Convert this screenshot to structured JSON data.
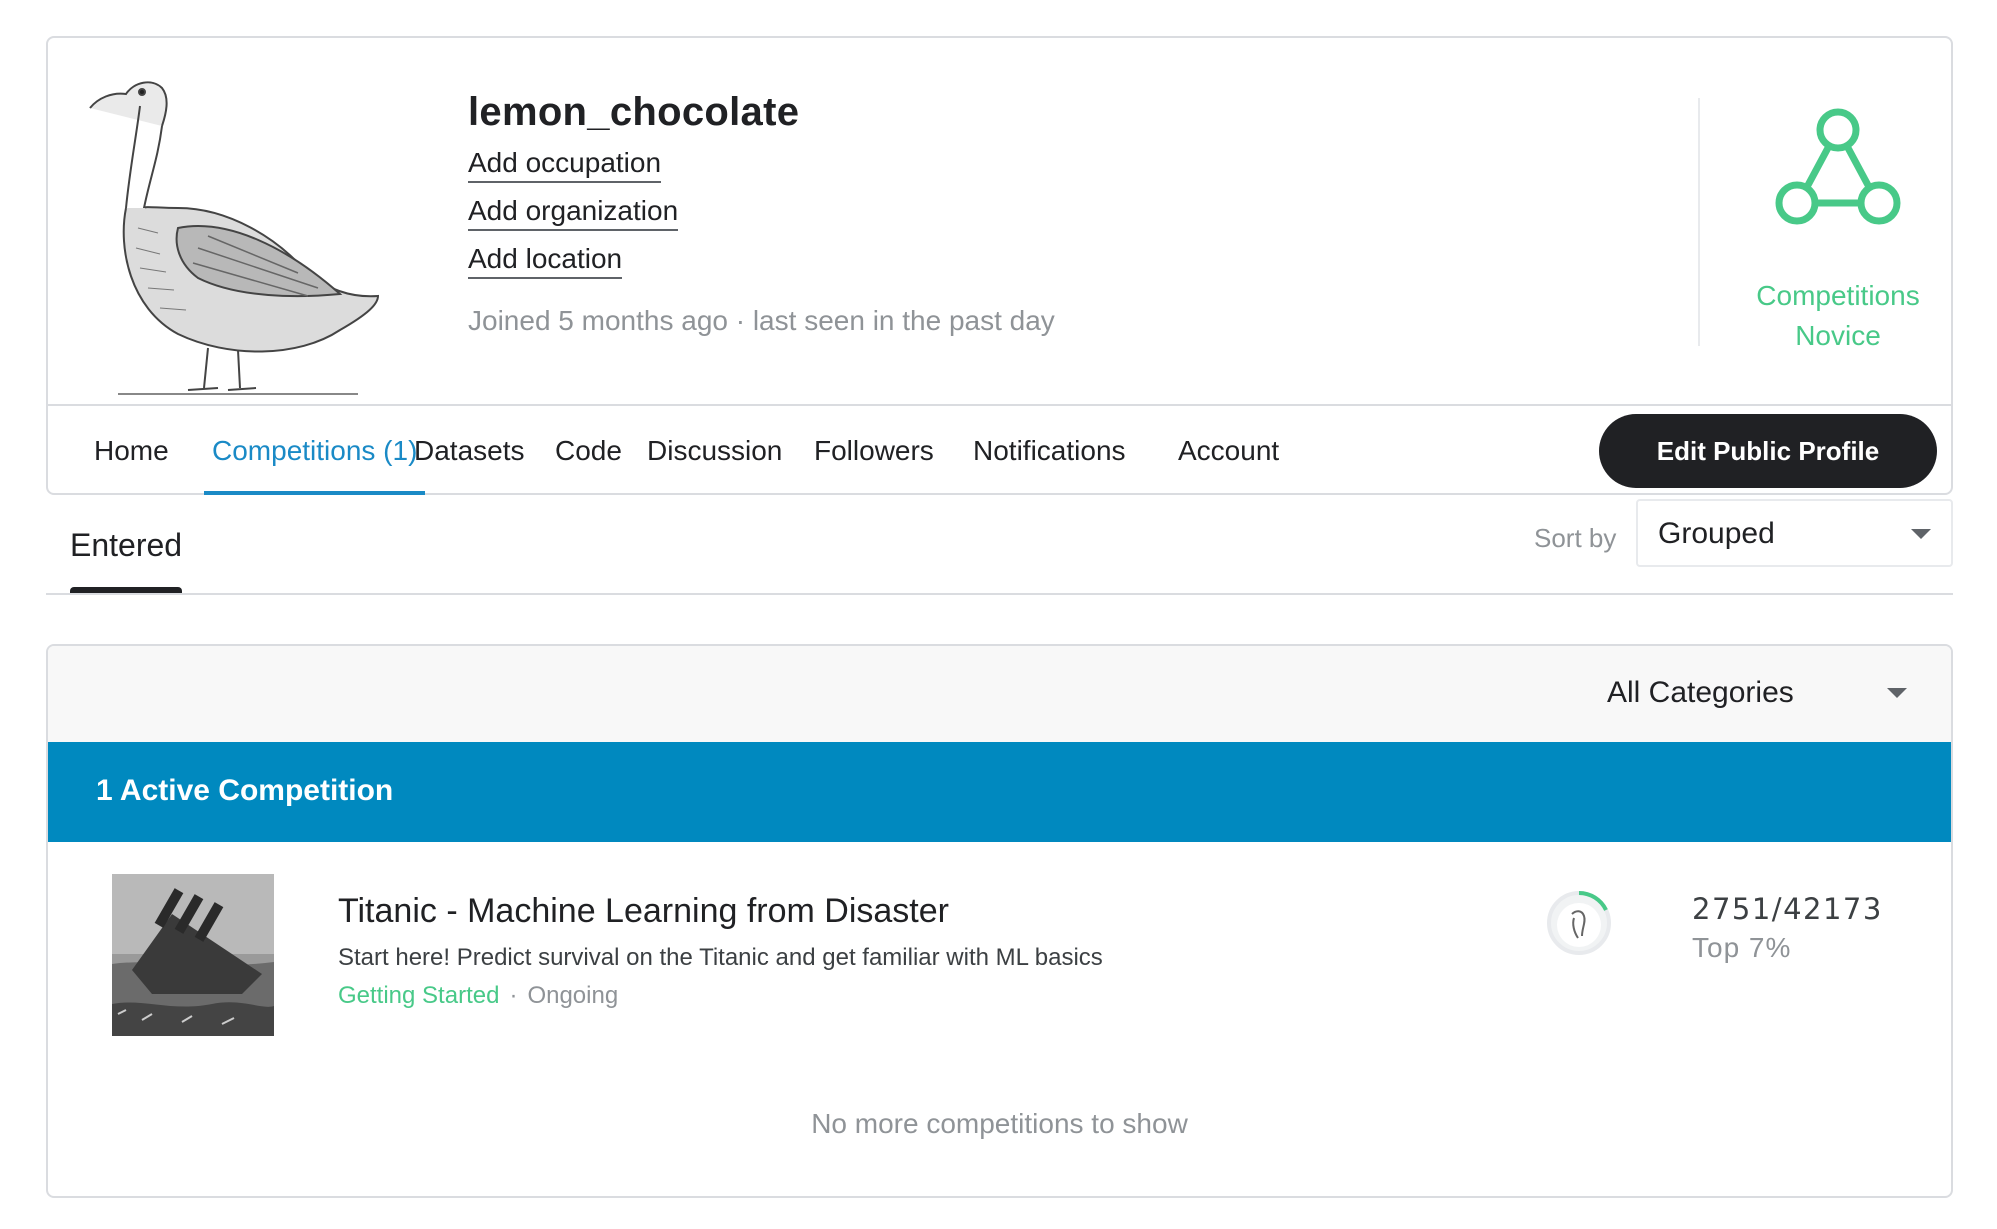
{
  "profile": {
    "username": "lemon_chocolate",
    "add_occupation": "Add occupation",
    "add_organization": "Add organization",
    "add_location": "Add location",
    "joined": "Joined 5 months ago · last seen in the past day",
    "tier_line1": "Competitions",
    "tier_line2": "Novice",
    "tier_color": "#48c988"
  },
  "nav": {
    "items": [
      "Home",
      "Competitions (1)",
      "Datasets",
      "Code",
      "Discussion",
      "Followers",
      "Notifications",
      "Account"
    ],
    "active": "Competitions (1)",
    "edit_button": "Edit Public Profile",
    "accent": "#1a8ac6"
  },
  "subtabs": {
    "entered": "Entered",
    "sort_label": "Sort by",
    "sort_value": "Grouped"
  },
  "list": {
    "category_filter": "All Categories",
    "active_header": "1 Active Competition",
    "banner_color": "#0089bf",
    "competitions": [
      {
        "title": "Titanic - Machine Learning from Disaster",
        "description": "Start here! Predict survival on the Titanic and get familiar with ML basics",
        "category": "Getting Started",
        "separator": "·",
        "status": "Ongoing",
        "rank": "2751/42173",
        "top": "Top 7%"
      }
    ],
    "empty_message": "No more competitions to show"
  }
}
